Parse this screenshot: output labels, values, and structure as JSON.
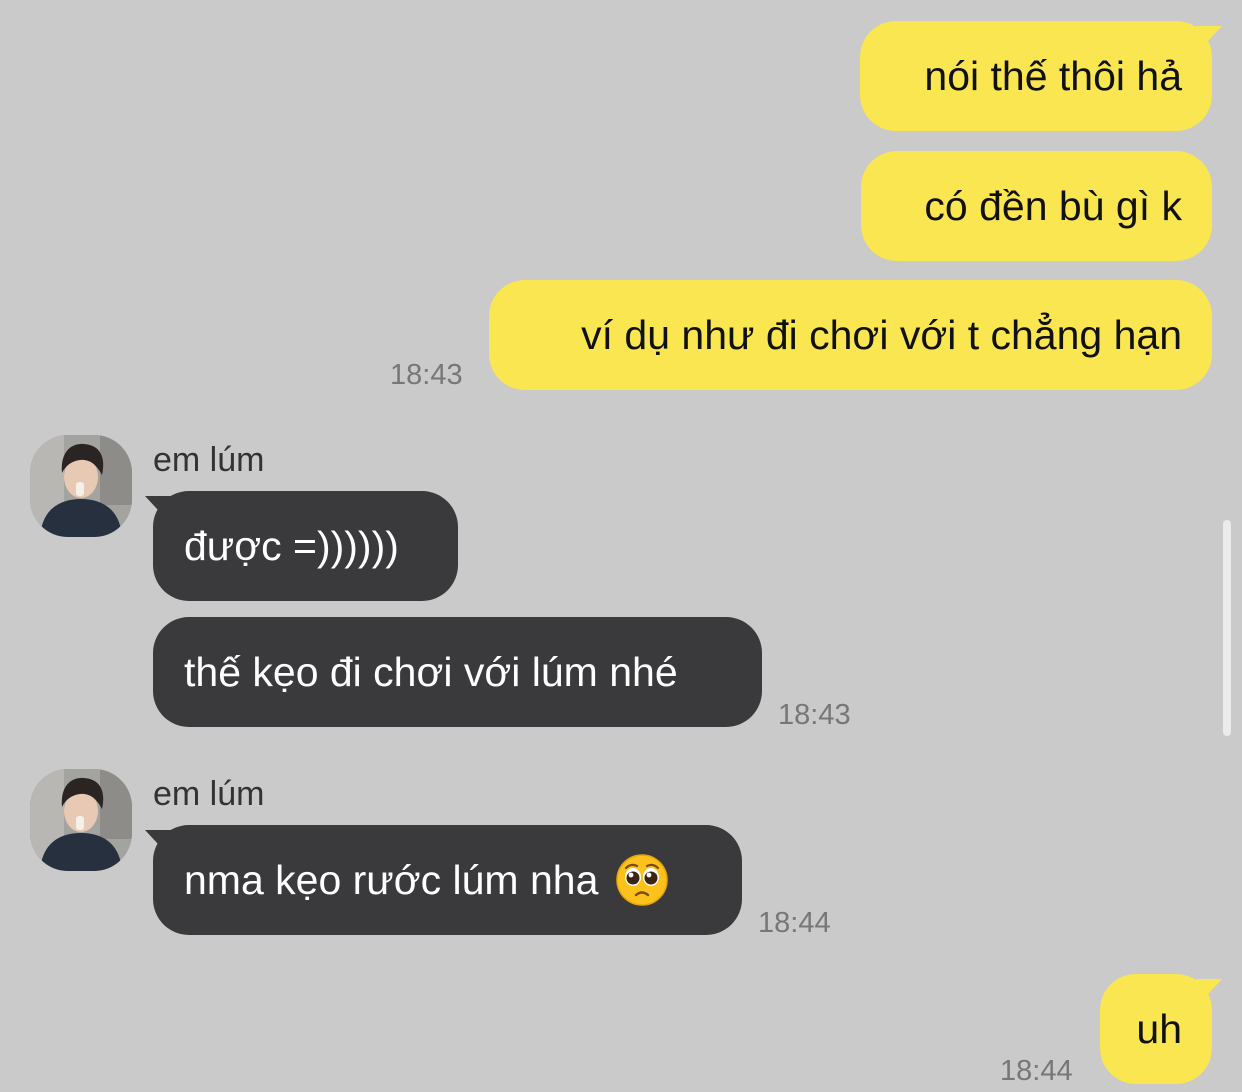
{
  "conversation": {
    "outgoing_1": {
      "text_1": "nói thế thôi hả",
      "text_2": "có đền bù gì k",
      "text_3": "ví dụ như đi chơi với t chẳng hạn",
      "time": "18:43"
    },
    "incoming_1": {
      "sender": "em lúm",
      "text_1": "được =))))))",
      "text_2": "thế kẹo đi chơi với lúm nhé",
      "time": "18:43"
    },
    "incoming_2": {
      "sender": "em lúm",
      "text_1": "nma kẹo rước lúm nha",
      "emoji": "pleading-face-emoji",
      "time": "18:44"
    },
    "outgoing_2": {
      "text_1": "uh",
      "time": "18:44"
    }
  },
  "colors": {
    "background": "#cacaca",
    "outgoing_bubble": "#fae650",
    "incoming_bubble": "#3a3a3c",
    "timestamp": "#777777"
  }
}
